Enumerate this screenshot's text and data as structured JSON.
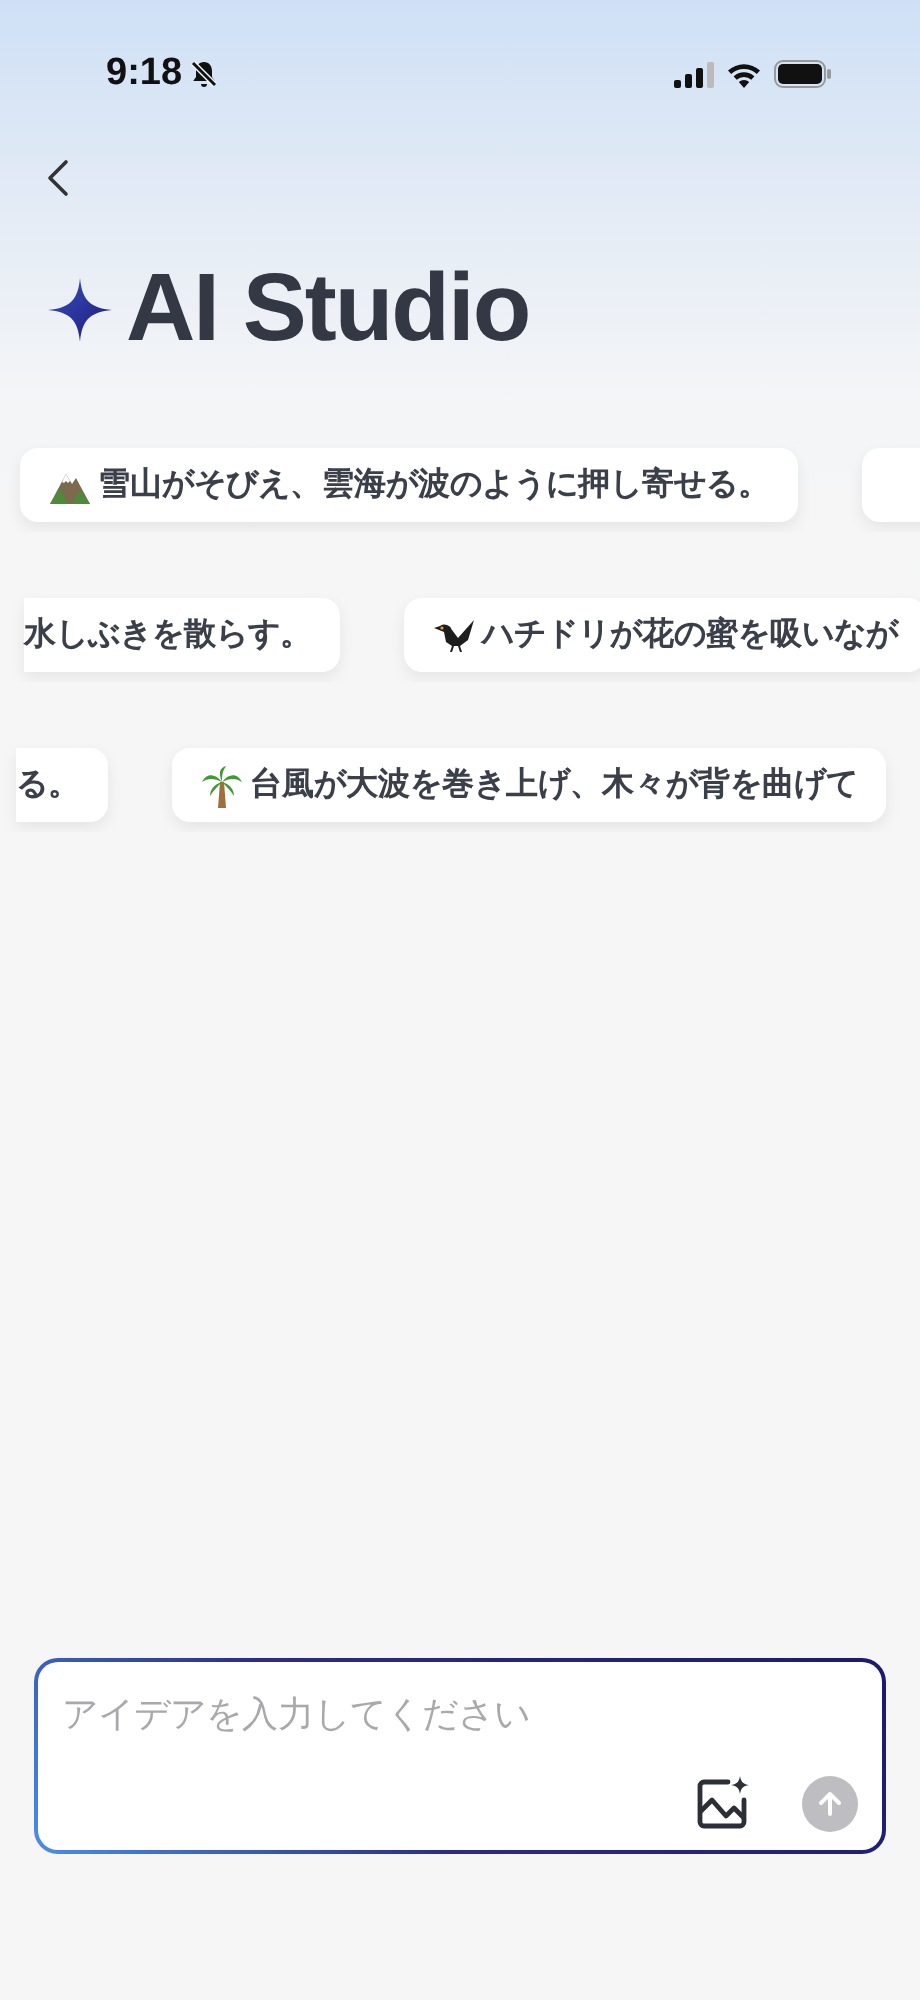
{
  "status_bar": {
    "time": "9:18",
    "silent": true
  },
  "title": "AI Studio",
  "suggestion_rows": [
    {
      "chips": [
        {
          "kind": "mountain",
          "text": "雪山がそびえ、雲海が波のように押し寄せる。"
        },
        {
          "kind": "empty"
        }
      ]
    },
    {
      "chips": [
        {
          "kind": "none",
          "text": "水しぶきを散らす。"
        },
        {
          "kind": "bird",
          "text": "ハチドリが花の蜜を吸いなが"
        }
      ]
    },
    {
      "chips": [
        {
          "kind": "none",
          "text": "る。"
        },
        {
          "kind": "palm",
          "text": "台風が大波を巻き上げ、木々が背を曲げて"
        }
      ]
    }
  ],
  "composer": {
    "placeholder": "アイデアを入力してください",
    "send_disabled": true
  }
}
